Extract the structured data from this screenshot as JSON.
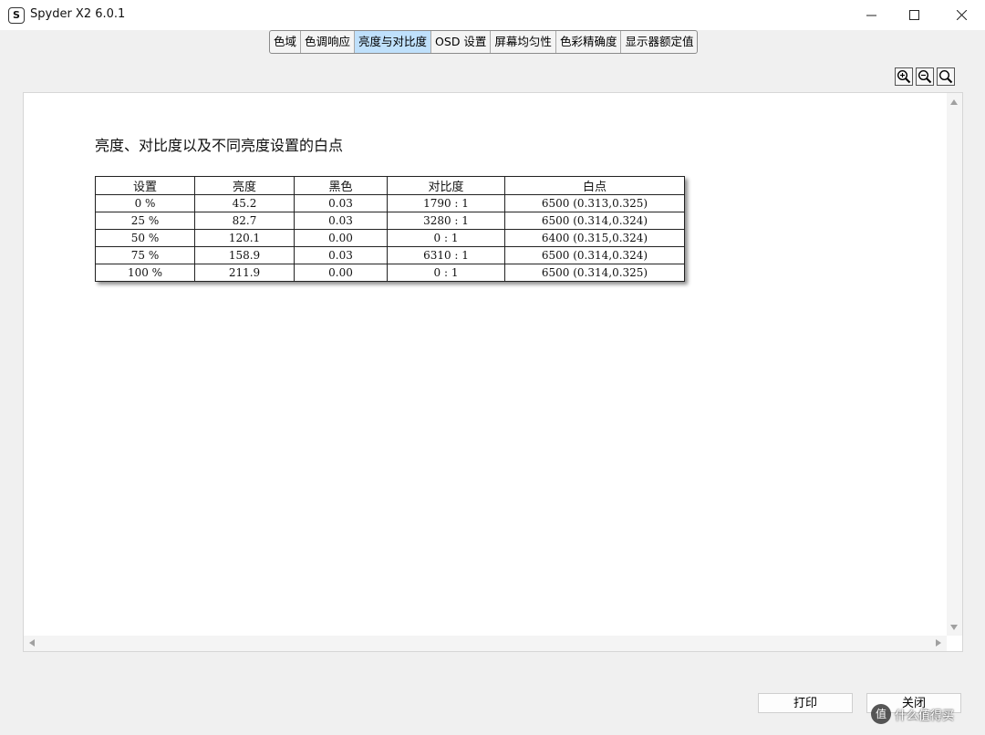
{
  "window": {
    "title": "Spyder X2 6.0.1",
    "icon_letter": "S"
  },
  "tabs": [
    {
      "label": "色域"
    },
    {
      "label": "色调响应"
    },
    {
      "label": "亮度与对比度",
      "active": true
    },
    {
      "label": "OSD 设置"
    },
    {
      "label": "屏幕均匀性"
    },
    {
      "label": "色彩精确度"
    },
    {
      "label": "显示器额定值"
    }
  ],
  "zoom_tools": [
    "zoom-in-icon",
    "zoom-out-icon",
    "zoom-fit-icon"
  ],
  "report": {
    "title": "亮度、对比度以及不同亮度设置的白点",
    "columns": [
      "设置",
      "亮度",
      "黑色",
      "对比度",
      "白点"
    ],
    "rows": [
      [
        "0 %",
        "45.2",
        "0.03",
        "1790 : 1",
        "6500 (0.313,0.325)"
      ],
      [
        "25 %",
        "82.7",
        "0.03",
        "3280 : 1",
        "6500 (0.314,0.324)"
      ],
      [
        "50 %",
        "120.1",
        "0.00",
        "0 : 1",
        "6400 (0.315,0.324)"
      ],
      [
        "75 %",
        "158.9",
        "0.03",
        "6310 : 1",
        "6500 (0.314,0.324)"
      ],
      [
        "100 %",
        "211.9",
        "0.00",
        "0 : 1",
        "6500 (0.314,0.325)"
      ]
    ]
  },
  "buttons": {
    "print": "打印",
    "close": "关闭"
  },
  "watermark": {
    "symbol": "值",
    "text": "什么值得买"
  },
  "colors": {
    "active_tab": "#bfe0fb",
    "window_bg": "#f0f0f0"
  }
}
